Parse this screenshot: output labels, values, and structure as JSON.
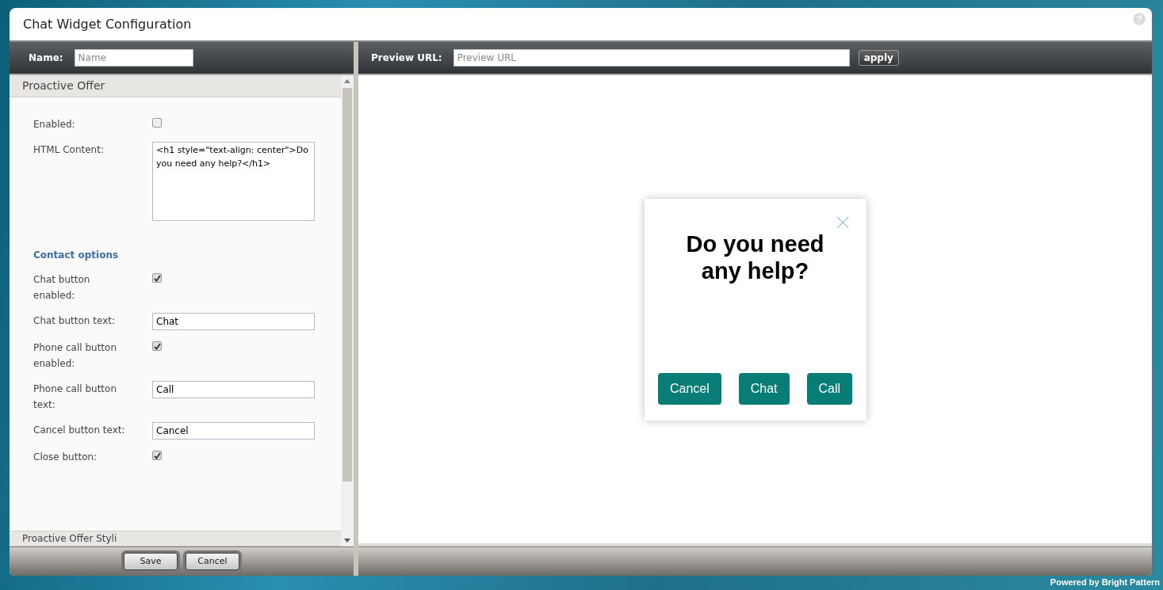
{
  "window": {
    "title": "Chat Widget Configuration"
  },
  "name_bar": {
    "label": "Name:",
    "placeholder": "Name"
  },
  "preview_bar": {
    "label": "Preview URL:",
    "placeholder": "Preview URL",
    "button": "apply"
  },
  "section": {
    "title": "Proactive Offer"
  },
  "fields": [
    {
      "kind": "checkbox",
      "label": "Enabled:",
      "checked": false
    },
    {
      "kind": "textarea",
      "label": "HTML Content:",
      "value": "<h1 style=\"text-align: center\">Do you need any help?</h1>"
    },
    {
      "kind": "heading",
      "label": "Contact options"
    },
    {
      "kind": "checkbox",
      "label": "Chat button enabled:",
      "checked": true
    },
    {
      "kind": "text",
      "label": "Chat button text:",
      "value": "Chat"
    },
    {
      "kind": "checkbox",
      "label": "Phone call button enabled:",
      "checked": true
    },
    {
      "kind": "text",
      "label": "Phone call button text:",
      "value": "Call"
    },
    {
      "kind": "text",
      "label": "Cancel button text:",
      "value": "Cancel"
    },
    {
      "kind": "checkbox",
      "label": "Close button:",
      "checked": true
    }
  ],
  "next_section": {
    "title": "Proactive Offer Styli"
  },
  "footer_buttons": [
    "Save",
    "Cancel"
  ],
  "preview": {
    "heading": "Do you need any help?",
    "close_button": true,
    "buttons": [
      "Cancel",
      "Chat",
      "Call"
    ]
  },
  "powered_by": "Powered by Bright Pattern"
}
